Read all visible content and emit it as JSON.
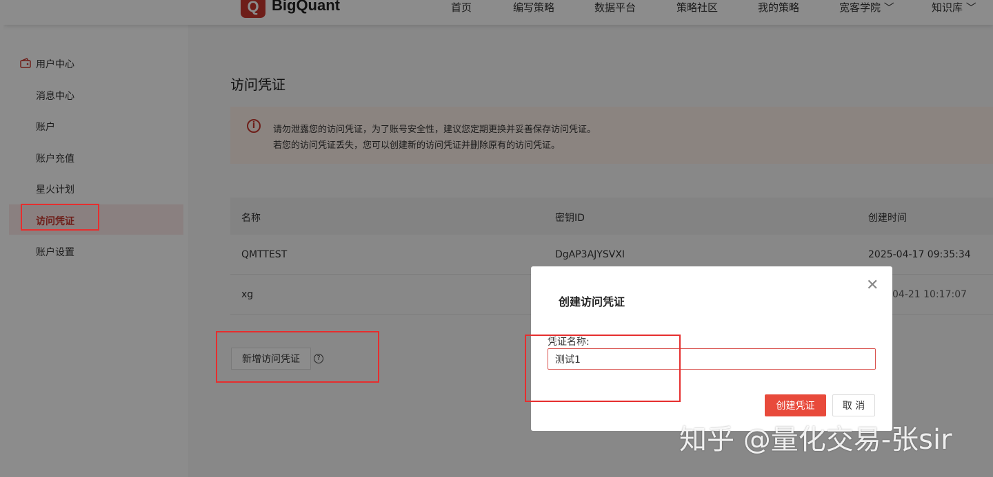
{
  "header": {
    "logo_mark": "Q",
    "logo_text": "BigQuant",
    "nav": [
      {
        "label": "首页"
      },
      {
        "label": "编写策略"
      },
      {
        "label": "数据平台"
      },
      {
        "label": "策略社区"
      },
      {
        "label": "我的策略"
      },
      {
        "label": "宽客学院 ﹀"
      },
      {
        "label": "知识库 ﹀"
      }
    ]
  },
  "sidebar": {
    "section_title": "用户中心",
    "section_icon": "wallet-icon",
    "items": [
      {
        "label": "消息中心"
      },
      {
        "label": "账户"
      },
      {
        "label": "账户充值"
      },
      {
        "label": "星火计划"
      },
      {
        "label": "访问凭证",
        "active": true
      },
      {
        "label": "账户设置"
      }
    ]
  },
  "main": {
    "title": "访问凭证",
    "alert": {
      "icon": "info-icon",
      "line1": "请勿泄露您的访问凭证，为了账号安全性，建议您定期更换并妥善保存访问凭证。",
      "line2": "若您的访问凭证丢失，您可以创建新的访问凭证并删除原有的访问凭证。"
    },
    "table": {
      "columns": [
        "名称",
        "密钥ID",
        "创建时间"
      ],
      "rows": [
        {
          "name": "QMTTEST",
          "key_id": "DgAP3AJYSVXI",
          "created": "2025-04-17 09:35:34"
        },
        {
          "name": "xg",
          "key_id": "",
          "created": "04-21 10:17:07"
        }
      ]
    },
    "add_button": "新增访问凭证",
    "help_icon": "question-circle-icon"
  },
  "modal": {
    "title": "创建访问凭证",
    "close_icon": "close-icon",
    "field_label": "凭证名称:",
    "field_value": "测试1",
    "confirm": "创建凭证",
    "cancel": "取 消"
  },
  "watermark": "知乎 @量化交易-张sir",
  "colors": {
    "brand": "#c8382e",
    "primary_button": "#e84a3b",
    "annotation": "#e62e2e",
    "alert_bg": "#fdf1ea"
  }
}
